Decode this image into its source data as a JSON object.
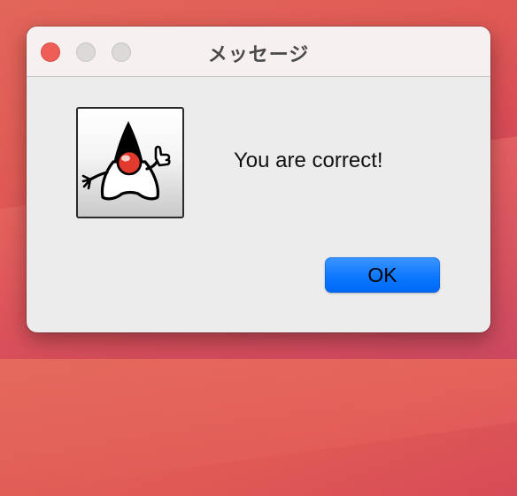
{
  "dialog": {
    "title": "メッセージ",
    "message": "You are correct!",
    "ok_label": "OK",
    "icon": "java-duke-icon"
  },
  "colors": {
    "accent_button": "#0a76ff",
    "close_button": "#ee5e57",
    "window_background": "#ececec"
  }
}
